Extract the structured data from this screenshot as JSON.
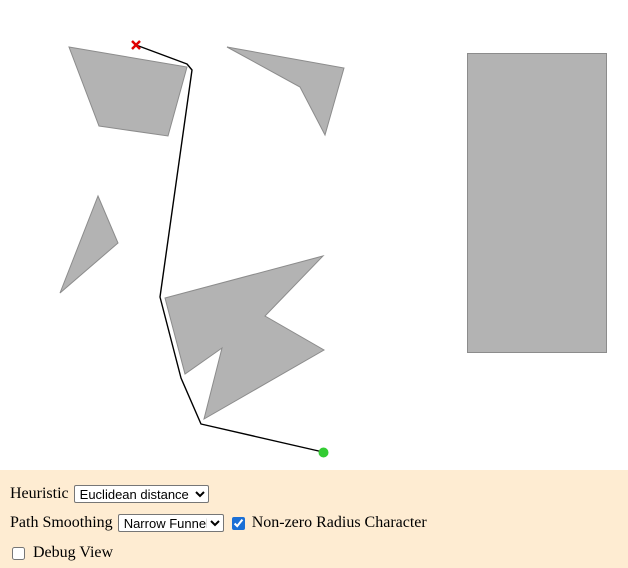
{
  "controls": {
    "heuristic": {
      "label": "Heuristic",
      "selected": "Euclidean distance"
    },
    "path_smoothing": {
      "label": "Path Smoothing",
      "selected": "Narrow Funnel"
    },
    "non_zero_radius": {
      "label": "Non-zero Radius Character",
      "checked": true
    },
    "debug_view": {
      "label": "Debug View",
      "checked": false
    }
  },
  "icons": {
    "start": "green-dot-icon",
    "goal": "red-x-icon"
  },
  "colors": {
    "obstacle_fill": "#b3b3b3",
    "obstacle_stroke": "#8c8c8c",
    "path": "#000000",
    "start": "#33cc33",
    "goal": "#e00000",
    "controls_background": "#feecd2"
  }
}
